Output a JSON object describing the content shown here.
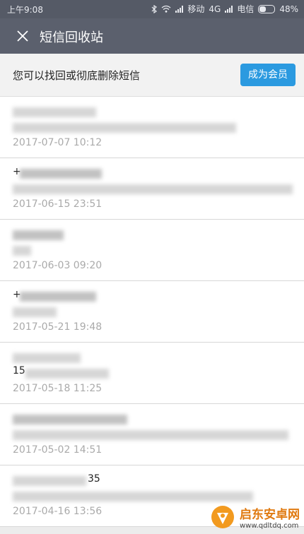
{
  "status_bar": {
    "time": "上午9:08",
    "carrier1": "移动",
    "network": "4G",
    "carrier2": "电信",
    "battery": "48%",
    "battery_level": 0.48
  },
  "header": {
    "title": "短信回收站",
    "close_icon": "close-icon"
  },
  "banner": {
    "text": "您可以找回或彻底删除短信",
    "button": "成为会员"
  },
  "messages": [
    {
      "date": "2017-07-07 10:12"
    },
    {
      "date": "2017-06-15 23:51",
      "prefix": "+"
    },
    {
      "date": "2017-06-03 09:20"
    },
    {
      "date": "2017-05-21 19:48",
      "prefix": "+"
    },
    {
      "date": "2017-05-18 11:25",
      "prefix": "15"
    },
    {
      "date": "2017-05-02 14:51"
    },
    {
      "date": "2017-04-16 13:56",
      "suffix": "35"
    }
  ],
  "watermark": {
    "name": "启东安卓网",
    "url": "www.qdltdq.com"
  }
}
